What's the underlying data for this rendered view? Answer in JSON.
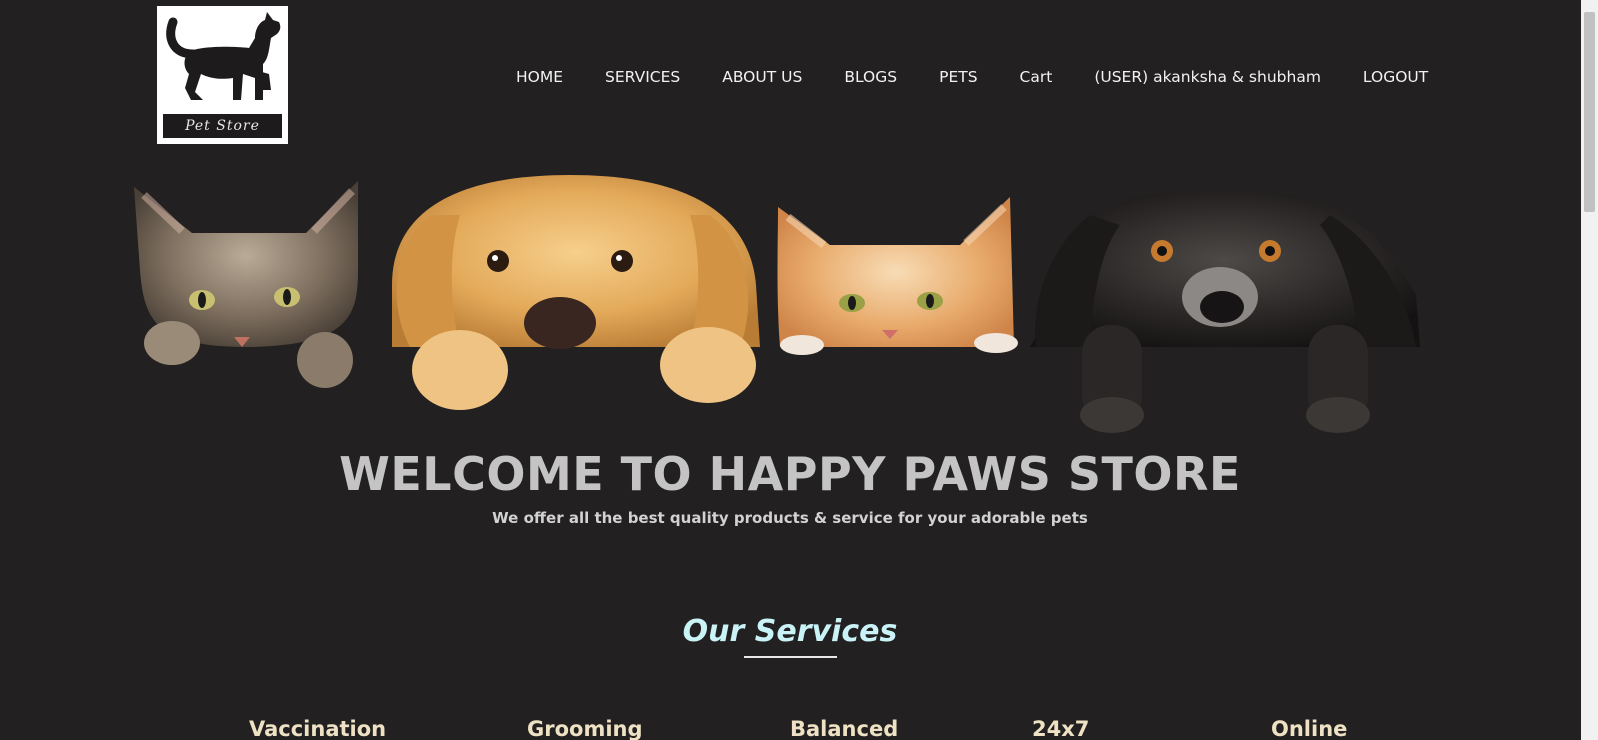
{
  "logo": {
    "band_text": "Pet Store"
  },
  "nav": {
    "items": [
      {
        "label": "HOME"
      },
      {
        "label": "SERVICES"
      },
      {
        "label": "ABOUT US"
      },
      {
        "label": "BLOGS"
      },
      {
        "label": "PETS"
      },
      {
        "label": "Cart"
      },
      {
        "label": "(USER) akanksha & shubham"
      },
      {
        "label": "LOGOUT"
      }
    ]
  },
  "hero": {
    "title": "WELCOME TO HAPPY PAWS STORE",
    "subtitle": "We offer all the best quality products & service for your adorable pets"
  },
  "services": {
    "heading": "Our Services",
    "items": [
      {
        "label": "Vaccination"
      },
      {
        "label": "Grooming"
      },
      {
        "label": "Balanced"
      },
      {
        "label": "24x7"
      },
      {
        "label": "Online"
      }
    ]
  },
  "colors": {
    "background": "#222020",
    "heading_accent": "#c9f3f7",
    "service_text": "#efe2c4",
    "hero_text": "#c4c4c4"
  },
  "icons": {
    "logo": "dog-silhouette-icon",
    "hero_image": "peeking-pets-banner"
  }
}
